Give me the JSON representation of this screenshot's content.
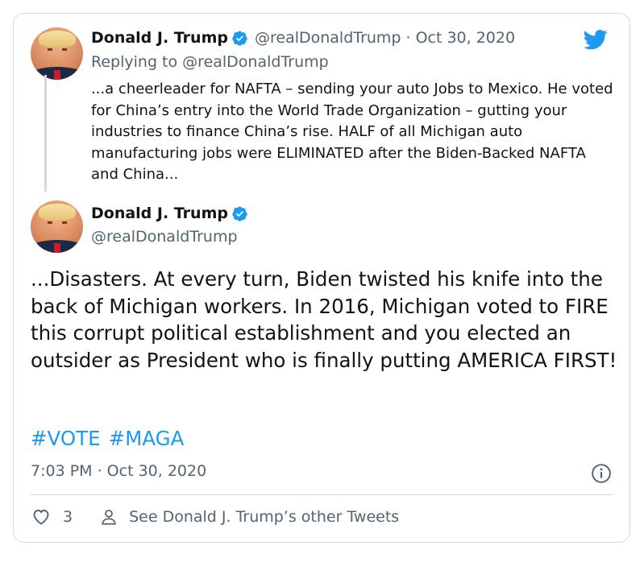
{
  "reply": {
    "author_name": "Donald J. Trump",
    "author_handle": "@realDonaldTrump",
    "date": "Oct 30, 2020",
    "replying_prefix": "Replying to",
    "replying_to": "@realDonaldTrump",
    "text": "...a cheerleader for NAFTA – sending your auto Jobs to Mexico. He voted for China’s entry into the World Trade Organization – gutting your industries to finance China’s rise. HALF of all Michigan auto manufacturing jobs were ELIMINATED after the Biden-Backed NAFTA and China..."
  },
  "tweet": {
    "author_name": "Donald J. Trump",
    "author_handle": "@realDonaldTrump",
    "text": "...Disasters. At every turn, Biden twisted his knife into the back of Michigan workers. In 2016, Michigan voted to FIRE this corrupt political establishment and you elected an outsider as President who is finally putting AMERICA FIRST!",
    "hashtags": [
      "#VOTE",
      "#MAGA"
    ],
    "timestamp": "7:03 PM · Oct 30, 2020",
    "like_count": "3",
    "profile_link_label": "See Donald J. Trump’s other Tweets"
  },
  "icons": {
    "brand": "twitter-bird-icon",
    "verified": "verified-badge-icon",
    "info": "info-icon",
    "like": "heart-icon",
    "profile": "person-icon"
  },
  "colors": {
    "accent": "#1d9bf0",
    "text": "#0f1419",
    "muted": "#536471",
    "border": "#cfd9de"
  }
}
